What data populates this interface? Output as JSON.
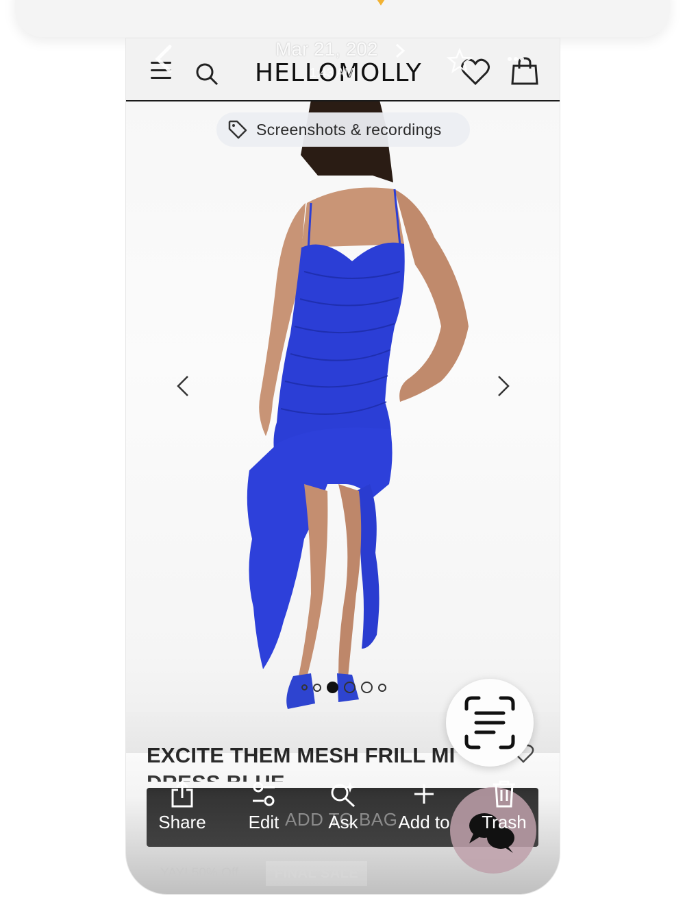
{
  "overlay": {
    "date": "Mar 21, 202",
    "time": "1:43 AM"
  },
  "header": {
    "brand": "HELLOMOLLY"
  },
  "pill": {
    "label": "Screenshots & recordings"
  },
  "carousel": {
    "count": 6,
    "active_index": 2
  },
  "product": {
    "title_line1": "EXCITE THEM MESH FRILL MI",
    "title_line2": "DRESS BLUE",
    "add_to_bag": "ADD TO BAG",
    "promo": "YAY! 50% Off",
    "badge": "FINAL SALE",
    "dress_color": "#2b3ed6"
  },
  "toolbar": {
    "share": "Share",
    "edit": "Edit",
    "ask": "Ask",
    "add_to": "Add to",
    "trash": "Trash"
  },
  "icons": {
    "back": "chevron-left-icon",
    "menu": "hamburger-icon",
    "search": "search-icon",
    "wishlist": "heart-icon",
    "bag": "shopping-bag-icon",
    "favorite": "star-icon",
    "lens": "text-scan-icon",
    "chat": "chat-icon"
  }
}
